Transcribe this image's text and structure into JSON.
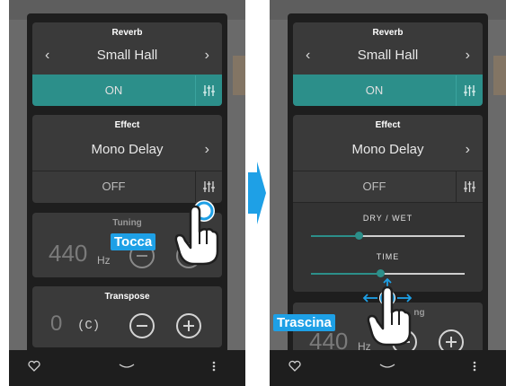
{
  "left": {
    "reverb": {
      "title": "Reverb",
      "value": "Small Hall",
      "state": "ON"
    },
    "effect": {
      "title": "Effect",
      "value": "Mono Delay",
      "state": "OFF"
    },
    "tuning": {
      "title": "Tuning",
      "value": "440",
      "unit": "Hz"
    },
    "transpose": {
      "title": "Transpose",
      "value": "0",
      "note": "(C)"
    },
    "callout": "Tocca"
  },
  "right": {
    "reverb": {
      "title": "Reverb",
      "value": "Small Hall",
      "state": "ON"
    },
    "effect": {
      "title": "Effect",
      "value": "Mono Delay",
      "state": "OFF",
      "params": [
        {
          "label": "DRY / WET",
          "level_pct": 31
        },
        {
          "label": "TIME",
          "level_pct": 45
        }
      ]
    },
    "tuning": {
      "title": "Tuning",
      "value_partial": "440",
      "unit_partial": "Hz"
    },
    "callout": "Trascina"
  },
  "colors": {
    "accent": "#2c8f8a",
    "callout": "#1ea0e6"
  },
  "icons": [
    "chevron-left-icon",
    "chevron-right-icon",
    "sliders-icon",
    "minus-icon",
    "plus-icon",
    "heart-icon",
    "chevron-down-icon",
    "more-icon",
    "hand-icon",
    "next-arrow-icon"
  ]
}
